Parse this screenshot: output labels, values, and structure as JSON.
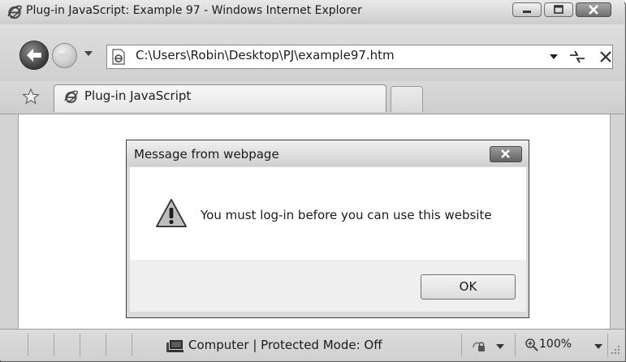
{
  "window": {
    "title": "Plug-in JavaScript: Example 97 - Windows Internet Explorer"
  },
  "addressbar": {
    "url": "C:\\Users\\Robin\\Desktop\\PJ\\example97.htm"
  },
  "tabs": [
    {
      "label": "Plug-in JavaScript",
      "active": true
    }
  ],
  "dialog": {
    "title": "Message from webpage",
    "message": "You must log-in before you can use this website",
    "ok_label": "OK"
  },
  "statusbar": {
    "zone": "Computer | Protected Mode: Off",
    "zoom": "100%"
  },
  "icons": {
    "titlebar": "ie-logo-icon",
    "back": "back-arrow-icon",
    "forward": "forward-arrow-icon",
    "page": "page-icon",
    "refresh": "refresh-icon",
    "stop": "stop-icon",
    "favorites": "favorites-star-icon",
    "warning": "warning-icon",
    "zone": "computer-zone-icon",
    "zoom": "zoom-icon"
  }
}
